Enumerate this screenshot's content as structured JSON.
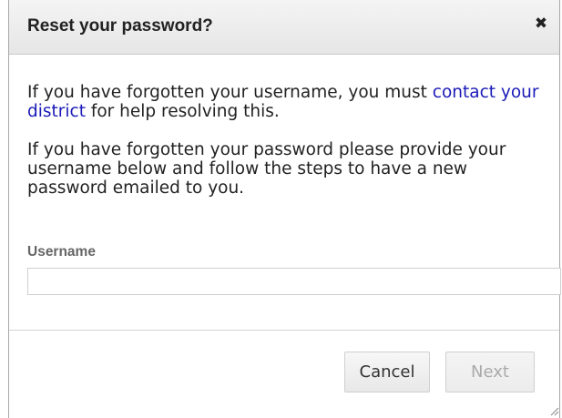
{
  "dialog": {
    "title": "Reset your password?",
    "close_icon": "close-icon",
    "paragraph1": {
      "before_link": "If you have forgotten your username, you must ",
      "link_text": "contact your district",
      "after_link": " for help resolving this."
    },
    "paragraph2": "If you have forgotten your password please provide your username below and follow the steps to have a new password emailed to you.",
    "username_label": "Username",
    "username_value": "",
    "buttons": {
      "cancel": "Cancel",
      "next": "Next"
    },
    "colors": {
      "link": "#1a1ab8",
      "disabled_text": "#aaaaaa"
    }
  }
}
